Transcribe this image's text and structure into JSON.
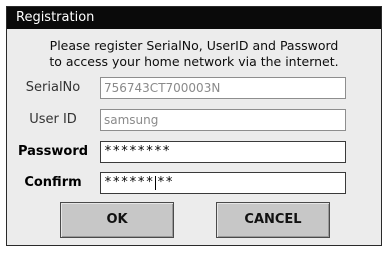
{
  "dialog": {
    "title": "Registration",
    "message_line1": "Please register SerialNo, UserID and Password",
    "message_line2": "to access your home network via the internet."
  },
  "fields": {
    "serial": {
      "label": "SerialNo",
      "value": "756743CT700003N"
    },
    "userid": {
      "label": "User ID",
      "value": "samsung"
    },
    "password": {
      "label": "Password",
      "value": "********"
    },
    "confirm": {
      "label": "Confirm",
      "value_before_caret": "******",
      "value_after_caret": "**"
    }
  },
  "buttons": {
    "ok": "OK",
    "cancel": "CANCEL"
  }
}
